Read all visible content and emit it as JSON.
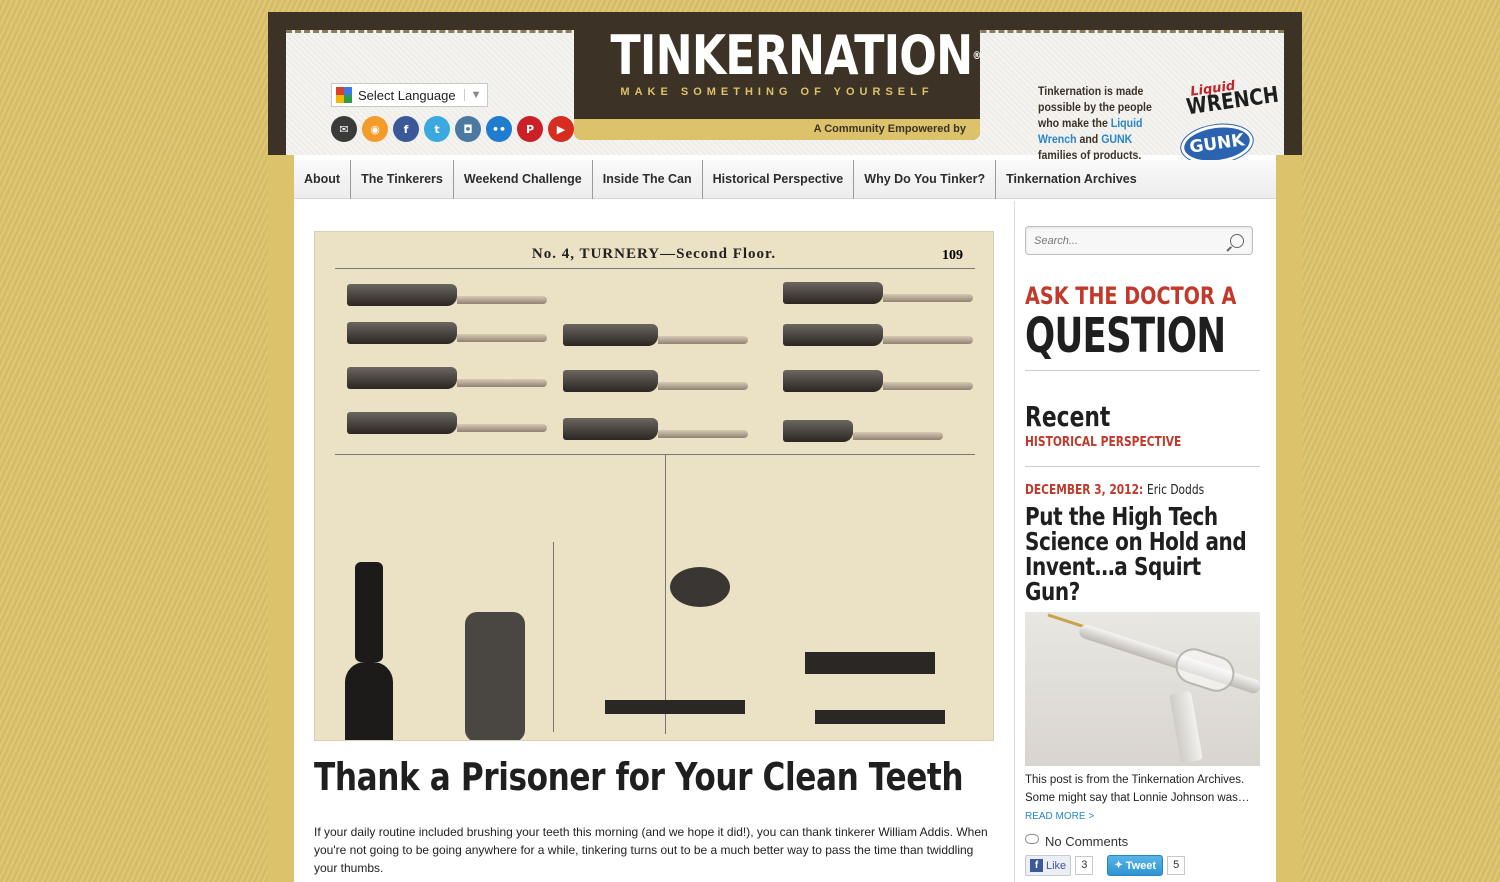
{
  "header": {
    "language_select": "Select Language",
    "logo_title": "TINKERNATION",
    "logo_reg": "®",
    "logo_tagline": "MAKE SOMETHING OF YOURSELF",
    "community_text": "A Community Empowered by",
    "sponsor_text_1": "Tinkernation is made possible by the people who make the",
    "sponsor_link_1": "Liquid Wrench",
    "sponsor_and": "and",
    "sponsor_link_2": "GUNK",
    "sponsor_text_2": "families of products.",
    "brand_liquid": "Liquid",
    "brand_wrench": "WRENCH",
    "brand_gunk": "GUNK"
  },
  "social_icons": [
    {
      "name": "email-icon",
      "glyph": "✉",
      "color": "#3a3a3a"
    },
    {
      "name": "rss-icon",
      "glyph": "◉",
      "color": "#f39c2a"
    },
    {
      "name": "facebook-icon",
      "glyph": "f",
      "color": "#3b5998"
    },
    {
      "name": "twitter-icon",
      "glyph": "t",
      "color": "#39a9e0"
    },
    {
      "name": "instagram-icon",
      "glyph": "◘",
      "color": "#4b79a1"
    },
    {
      "name": "flickr-icon",
      "glyph": "••",
      "color": "#1f7ccf"
    },
    {
      "name": "pinterest-icon",
      "glyph": "P",
      "color": "#cb2027"
    },
    {
      "name": "youtube-icon",
      "glyph": "▶",
      "color": "#d62d20"
    }
  ],
  "nav": {
    "items": [
      "About",
      "The Tinkerers",
      "Weekend Challenge",
      "Inside The Can",
      "Historical Perspective",
      "Why Do You Tinker?",
      "Tinkernation Archives"
    ]
  },
  "main": {
    "hero_heading": "No. 4, TURNERY—Second Floor.",
    "hero_page": "109",
    "post_title": "Thank a Prisoner for Your Clean Teeth",
    "post_excerpt": "If your daily routine included brushing your teeth this morning (and we hope it did!), you can thank tinkerer William Addis. When you're not going to be going anywhere for a while, tinkering turns out to be a much better way to pass the time than twiddling your thumbs."
  },
  "sidebar": {
    "search_placeholder": "Search...",
    "ask_line1": "ASK THE DOCTOR A",
    "ask_line2": "QUESTION",
    "recent_heading": "Recent",
    "recent_category": "HISTORICAL PERSPECTIVE",
    "recent_date": "DECEMBER 3, 2012:",
    "recent_author": "Eric Dodds",
    "recent_title": "Put the High Tech Science on Hold and Invent…a Squirt Gun?",
    "recent_excerpt": "This post is from the Tinkernation Archives. Some might say that Lonnie Johnson was…",
    "read_more": "READ MORE >",
    "comments": "No Comments",
    "like_label": "Like",
    "like_count": "3",
    "tweet_label": "Tweet",
    "tweet_count": "5"
  }
}
